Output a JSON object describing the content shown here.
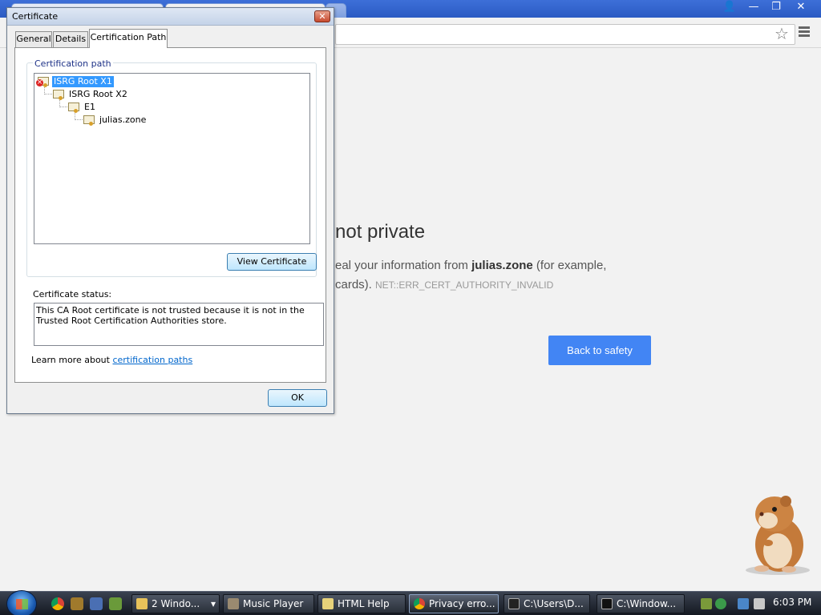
{
  "browser": {
    "window_controls": {
      "user": "👤",
      "minimize": "—",
      "maximize": "❐",
      "close": "✕"
    }
  },
  "page": {
    "heading": "not private",
    "line1_prefix": "eal your information from ",
    "line1_domain": "julias.zone",
    "line1_suffix": " (for example,",
    "line2_prefix": "cards). ",
    "error_code": "NET::ERR_CERT_AUTHORITY_INVALID",
    "back_button": "Back to safety",
    "accent_color": "#4285f4"
  },
  "dialog": {
    "title": "Certificate",
    "close": "✕",
    "tabs": [
      {
        "label": "General"
      },
      {
        "label": "Details"
      },
      {
        "label": "Certification Path",
        "active": true
      }
    ],
    "group_label": "Certification path",
    "tree": [
      {
        "label": "ISRG Root X1",
        "selected": true,
        "error": true
      },
      {
        "label": "ISRG Root X2"
      },
      {
        "label": "E1"
      },
      {
        "label": "julias.zone"
      }
    ],
    "view_certificate": "View Certificate",
    "status_label": "Certificate status:",
    "status_text": "This CA Root certificate is not trusted because it is not in the Trusted Root Certification Authorities store.",
    "learn_more_prefix": "Learn more about ",
    "learn_more_link": "certification paths",
    "ok": "OK"
  },
  "taskbar": {
    "buttons": [
      {
        "label": "2 Windo...",
        "icon": "folder-icon"
      },
      {
        "label": "Music Player",
        "icon": "music-icon"
      },
      {
        "label": "HTML Help",
        "icon": "help-icon"
      },
      {
        "label": "Privacy erro...",
        "icon": "chrome-icon",
        "active": true
      },
      {
        "label": "C:\\Users\\D...",
        "icon": "7zip-icon"
      },
      {
        "label": "C:\\Window...",
        "icon": "cmd-icon"
      }
    ],
    "clock": "6:03 PM"
  }
}
